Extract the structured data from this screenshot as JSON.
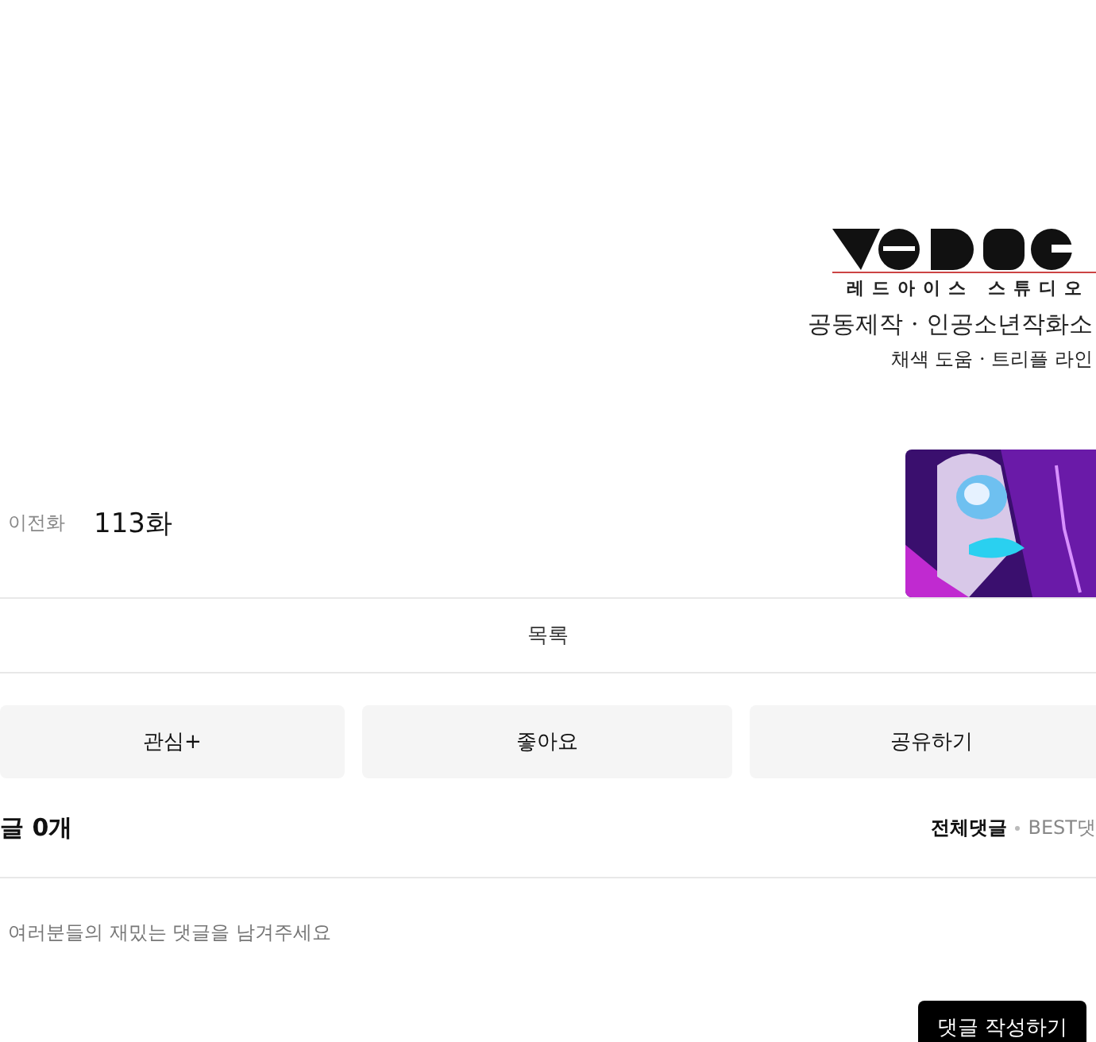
{
  "credits": {
    "studio": "레드아이스 스튜디오",
    "lines": [
      "공동제작 · 인공소년작화소",
      "채색 도움 · 트리플 라인"
    ]
  },
  "episode": {
    "prev_label": "이전화",
    "title": "113화"
  },
  "list_button": "목록",
  "actions": [
    "관심+",
    "좋아요",
    "공유하기"
  ],
  "comments": {
    "count_label": "글 0개",
    "sort": [
      {
        "label": "전체댓글",
        "selected": true
      },
      {
        "label": "BEST댓",
        "selected": false
      }
    ]
  },
  "comment_input": {
    "placeholder": "여러분들의 재밌는 댓글을 남겨주세요"
  },
  "submit_button": "댓글 작성하기"
}
